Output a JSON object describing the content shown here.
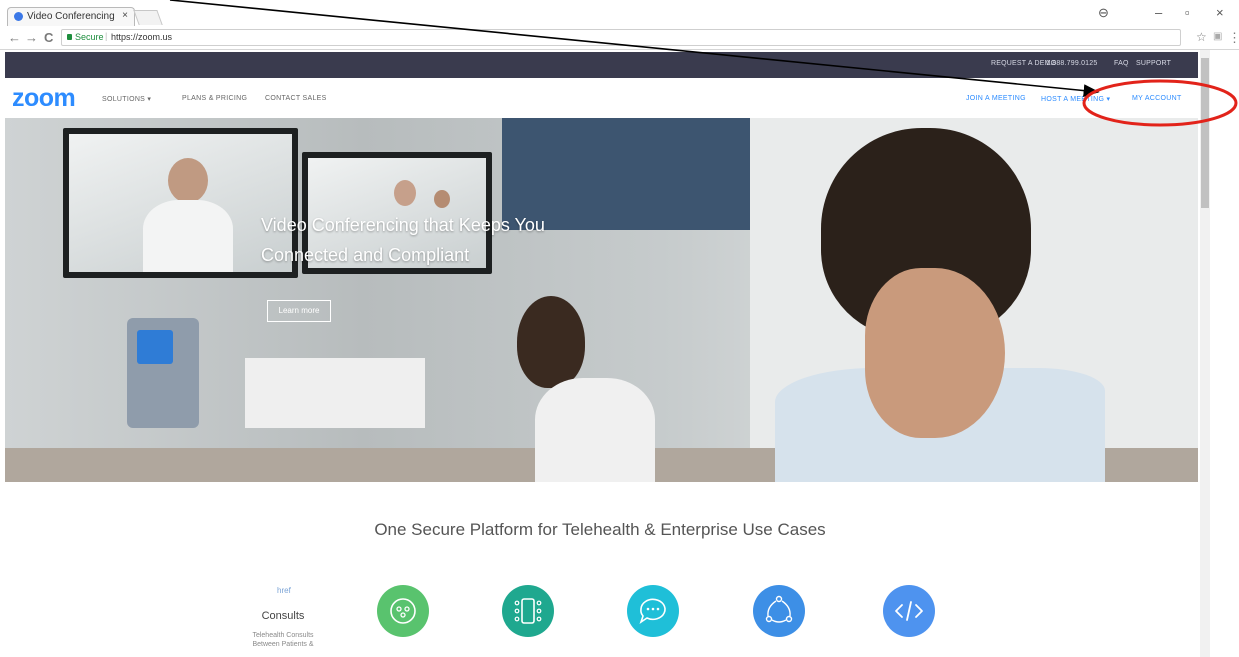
{
  "browser": {
    "tab_title": "Video Conferencing, We",
    "tab_close": "×",
    "window_controls": {
      "account": "⊖",
      "minimize": "–",
      "maximize": "▫",
      "close": "×"
    },
    "nav": {
      "back": "←",
      "forward": "→",
      "reload": "C"
    },
    "security_label": "Secure",
    "url": "https://zoom.us",
    "star": "☆",
    "menu": "⋮"
  },
  "topbar": {
    "request_demo": "REQUEST A DEMO",
    "phone": "1.888.799.0125",
    "faq": "FAQ",
    "support": "SUPPORT"
  },
  "nav": {
    "logo": "zoom",
    "solutions": "SOLUTIONS ▾",
    "plans": "PLANS & PRICING",
    "contact": "CONTACT SALES",
    "join": "JOIN A MEETING",
    "host": "HOST A MEETING ▾",
    "account": "MY ACCOUNT"
  },
  "hero": {
    "title_line1": "Video Conferencing that Keeps You",
    "title_line2": "Connected and Compliant",
    "button": "Learn more"
  },
  "content": {
    "headline": "One Secure Platform for Telehealth & Enterprise Use Cases",
    "href_text": "href",
    "card_title": "Consults",
    "card_desc_line1": "Telehealth Consults",
    "card_desc_line2": "Between Patients &",
    "circle_colors": [
      "#59c36e",
      "#1fa88f",
      "#1fbfd8",
      "#3d8fe6",
      "#4e93ef"
    ],
    "icons": [
      "video-device-icon",
      "mobile-device-icon",
      "chat-bubble-icon",
      "share-network-icon",
      "code-icon"
    ]
  },
  "annotation": {
    "arrow_color": "#000000",
    "circle_color": "#e2231a"
  }
}
